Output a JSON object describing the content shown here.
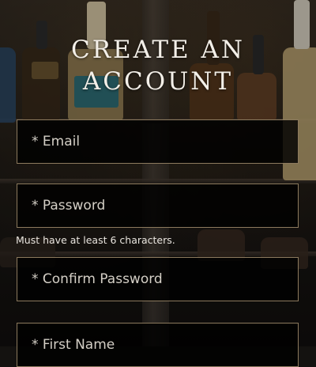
{
  "form": {
    "title_line1": "CREATE AN",
    "title_line2": "ACCOUNT",
    "email_placeholder": "* Email",
    "password_placeholder": "* Password",
    "password_hint": "Must have at least 6 characters.",
    "confirm_password_placeholder": "* Confirm Password",
    "first_name_placeholder": "* First Name"
  },
  "colors": {
    "field_border": "#8c7a5e",
    "field_background": "#000000",
    "title_text": "#f3efe8"
  }
}
